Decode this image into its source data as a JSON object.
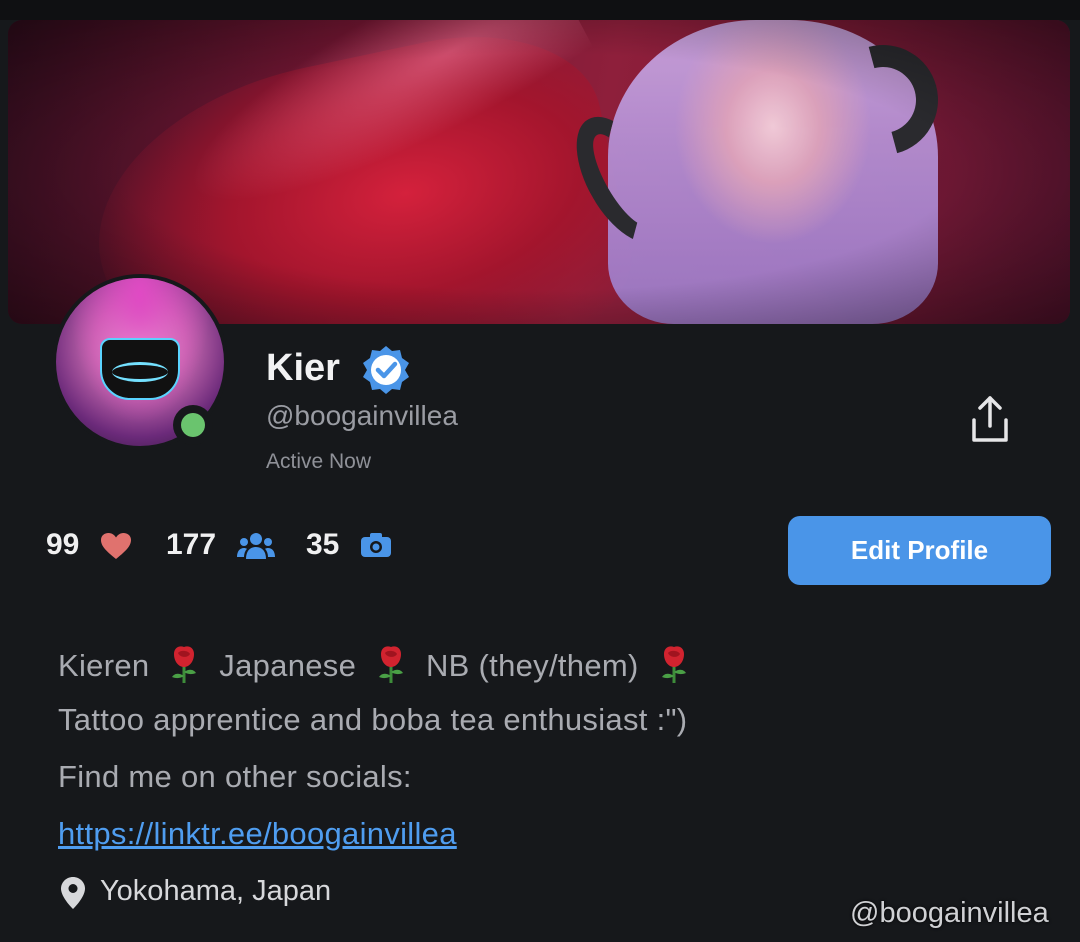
{
  "profile": {
    "display_name": "Kier",
    "handle": "@boogainvillea",
    "status": "Active Now",
    "verified_icon": "verified-badge-icon",
    "online_indicator_color": "#6ac46e"
  },
  "stats": {
    "likes": "99",
    "likes_icon": "heart-icon",
    "fans": "177",
    "fans_icon": "users-icon",
    "photos": "35",
    "photos_icon": "camera-icon"
  },
  "actions": {
    "edit_profile_label": "Edit Profile",
    "share_icon": "share-icon"
  },
  "bio": {
    "line1_part1": "Kieren",
    "line1_part2": "Japanese",
    "line1_part3": "NB (they/them)",
    "line2": "Tattoo apprentice and boba tea enthusiast :\")",
    "line3": "Find me on other socials:",
    "link": "https://linktr.ee/boogainvillea",
    "location": "Yokohama, Japan",
    "emoji_icon": "rose-emoji-icon"
  },
  "watermark": "@boogainvillea",
  "colors": {
    "accent": "#4a95e8",
    "background": "#16181b",
    "heart": "#e0726e",
    "link": "#4f9df0"
  }
}
